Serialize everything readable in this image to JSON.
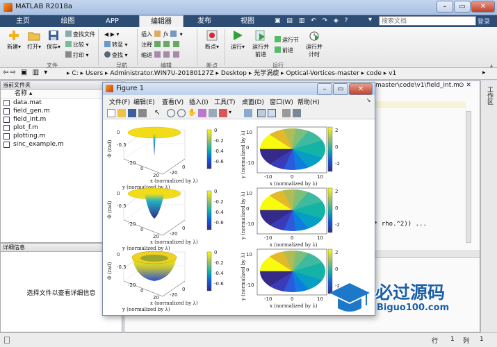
{
  "window": {
    "title": "MATLAB R2018a"
  },
  "tabs": [
    {
      "label": "主页",
      "active": false
    },
    {
      "label": "绘图",
      "active": false
    },
    {
      "label": "APP",
      "active": false
    },
    {
      "label": "编辑器",
      "active": true
    },
    {
      "label": "发布",
      "active": false
    },
    {
      "label": "视图",
      "active": false
    }
  ],
  "search": {
    "placeholder": "搜索文档",
    "login": "登录"
  },
  "ribbon": {
    "new": "新建",
    "open": "打开",
    "save": "保存",
    "find_files": "查找文件",
    "compare": "比较",
    "print": "打印",
    "goto": "转至",
    "find": "查找",
    "insert": "插入",
    "comment": "注释",
    "indent": "缩进",
    "breakpoints": "断点",
    "run": "运行",
    "run_advance": [
      "运行并",
      "前进"
    ],
    "run_section": "运行节",
    "advance": "前进",
    "run_time": [
      "运行并",
      "计时"
    ],
    "groups": {
      "file": "文件",
      "nav": "导航",
      "edit": "编辑",
      "bp": "断点",
      "run": "运行"
    }
  },
  "address": {
    "segments": [
      "C:",
      "Users",
      "Administrator.WIN7U-20180127Z",
      "Desktop",
      "光学涡旋",
      "Optical-Vortices-master",
      "code",
      "v1"
    ]
  },
  "file_panel": {
    "title": "当前文件夹",
    "column": "名称",
    "files": [
      "data.mat",
      "field_gen.m",
      "field_int.m",
      "plot_f.m",
      "plotting.m",
      "sinc_example.m"
    ]
  },
  "details_panel": {
    "title": "详细信息",
    "hint": "选择文件以查看详细信息"
  },
  "editor": {
    "path_tail": "master\\code\\v1\\field_int.m",
    "code_fragment": "* rho.^2)) ...",
    "side_label": "工作区"
  },
  "figure": {
    "title": "Figure 1",
    "menu": [
      "文件(F)",
      "编辑(E)",
      "查看(V)",
      "插入(I)",
      "工具(T)",
      "桌面(D)",
      "窗口(W)",
      "帮助(H)"
    ]
  },
  "chart_data": [
    {
      "type": "surface",
      "row": 1,
      "panel": "left",
      "xlabel": "x (normalized by λ)",
      "ylabel": "y (normalized by λ)",
      "zlabel": "Φ (rad)",
      "xticks": [
        "-20",
        "0"
      ],
      "yticks": [
        "-20",
        "0",
        "20"
      ],
      "colorbar_ticks": [
        "0",
        "-0.2",
        "-0.4",
        "-0.6"
      ],
      "clim": [
        -0.7,
        0
      ]
    },
    {
      "type": "heatmap",
      "row": 1,
      "panel": "right",
      "xlabel": "x (normalized by λ)",
      "ylabel": "y (normalized by λ)",
      "xticks": [
        "-10",
        "0",
        "10"
      ],
      "yticks": [
        "10",
        "0",
        "-10"
      ],
      "colorbar_ticks": [
        "2",
        "0",
        "-2"
      ],
      "clim": [
        -3.14,
        3.14
      ]
    },
    {
      "type": "surface",
      "row": 2,
      "panel": "left",
      "xlabel": "x (normalized by λ)",
      "ylabel": "y (normalized by λ)",
      "zlabel": "Φ (rad)",
      "xticks": [
        "-20",
        "0"
      ],
      "yticks": [
        "-20",
        "0",
        "20"
      ],
      "colorbar_ticks": [
        "0",
        "-0.2",
        "-0.4",
        "-0.6"
      ],
      "clim": [
        -0.7,
        0
      ]
    },
    {
      "type": "heatmap",
      "row": 2,
      "panel": "right",
      "xlabel": "x (normalized by λ)",
      "ylabel": "y (normalized by λ)",
      "xticks": [
        "-10",
        "0",
        "10"
      ],
      "yticks": [
        "10",
        "0",
        "-10"
      ],
      "colorbar_ticks": [
        "2",
        "0",
        "-2"
      ],
      "clim": [
        -3.14,
        3.14
      ]
    },
    {
      "type": "surface",
      "row": 3,
      "panel": "left",
      "xlabel": "x (normalized by λ)",
      "ylabel": "y (normalized by λ)",
      "zlabel": "Φ (rad)",
      "xticks": [
        "-20",
        "0"
      ],
      "yticks": [
        "-20",
        "0",
        "20"
      ],
      "colorbar_ticks": [
        "0",
        "-0.2",
        "-0.4",
        "-0.6"
      ],
      "clim": [
        -0.7,
        0
      ]
    },
    {
      "type": "heatmap",
      "row": 3,
      "panel": "right",
      "xlabel": "x (normalized by λ)",
      "ylabel": "y (normalized by λ)",
      "xticks": [
        "-10",
        "0",
        "10"
      ],
      "yticks": [
        "10",
        "0",
        "-10"
      ],
      "colorbar_ticks": [
        "2",
        "0",
        "-2"
      ],
      "clim": [
        -3.14,
        3.14
      ]
    }
  ],
  "status": {
    "row_label": "行",
    "row": "1",
    "col_label": "列",
    "col": "1"
  },
  "watermark": {
    "cn": "必过源码",
    "en": "Biguo100.com"
  }
}
